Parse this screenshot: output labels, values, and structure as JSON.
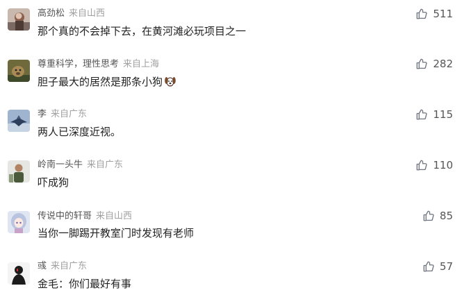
{
  "comments": [
    {
      "username": "高劲松",
      "location": "来自山西",
      "text": "那个真的不会掉下去，在黄河滩必玩项目之一",
      "likes": "511",
      "avatar_icon": "user-photo-avatar"
    },
    {
      "username": "尊重科学，理性思考",
      "location": "来自上海",
      "text": "胆子最大的居然是那条小狗",
      "text_emoji": "dog-face-emoji",
      "likes": "282",
      "avatar_icon": "animal-photo-avatar"
    },
    {
      "username": "李",
      "location": "来自广东",
      "text": "两人已深度近视。",
      "likes": "115",
      "avatar_icon": "fighter-jet-avatar"
    },
    {
      "username": "岭南一头牛",
      "location": "来自广东",
      "text": "吓成狗",
      "likes": "110",
      "avatar_icon": "person-photo-avatar"
    },
    {
      "username": "传说中的轩哥",
      "location": "来自山西",
      "text": "当你一脚踢开教室门时发现有老师",
      "likes": "85",
      "avatar_icon": "anime-girl-avatar"
    },
    {
      "username": "彧",
      "location": "来自广东",
      "text": "金毛：你们最好有事",
      "likes": "57",
      "avatar_icon": "dark-figure-avatar"
    }
  ],
  "colors": {
    "username": "#555555",
    "location": "#a0a0a0",
    "text": "#222222",
    "like": "#555555",
    "like_icon": "#6f7680"
  }
}
